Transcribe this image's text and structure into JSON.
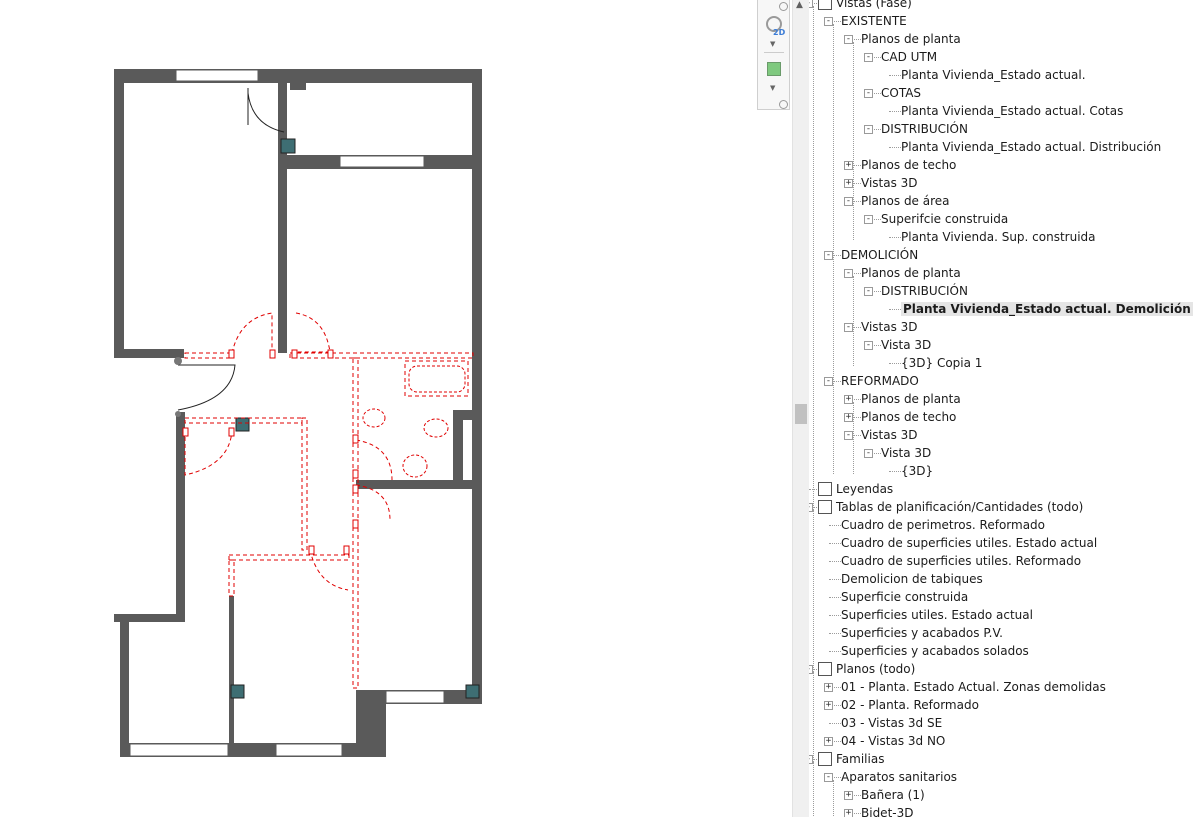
{
  "tree": {
    "rows": [
      {
        "id": "r0",
        "label": "Vistas (Fase)",
        "level": 0,
        "exp": "-",
        "icon": "view-folder-icon"
      },
      {
        "id": "r1",
        "label": "EXISTENTE",
        "level": 1,
        "exp": "-"
      },
      {
        "id": "r2",
        "label": "Planos de planta",
        "level": 2,
        "exp": "-"
      },
      {
        "id": "r3",
        "label": "CAD UTM",
        "level": 3,
        "exp": "-"
      },
      {
        "id": "r4",
        "label": "Planta Vivienda_Estado actual.",
        "level": 4
      },
      {
        "id": "r5",
        "label": "COTAS",
        "level": 3,
        "exp": "-"
      },
      {
        "id": "r6",
        "label": "Planta Vivienda_Estado actual. Cotas",
        "level": 4
      },
      {
        "id": "r7",
        "label": "DISTRIBUCIÓN",
        "level": 3,
        "exp": "-"
      },
      {
        "id": "r8",
        "label": "Planta Vivienda_Estado actual. Distribución",
        "level": 4
      },
      {
        "id": "r9",
        "label": "Planos de techo",
        "level": 2,
        "exp": "+"
      },
      {
        "id": "r10",
        "label": "Vistas 3D",
        "level": 2,
        "exp": "+"
      },
      {
        "id": "r11",
        "label": "Planos de área",
        "level": 2,
        "exp": "-"
      },
      {
        "id": "r12",
        "label": "Superifcie construida",
        "level": 3,
        "exp": "-"
      },
      {
        "id": "r13",
        "label": "Planta Vivienda. Sup. construida",
        "level": 4
      },
      {
        "id": "r14",
        "label": "DEMOLICIÓN",
        "level": 1,
        "exp": "-"
      },
      {
        "id": "r15",
        "label": "Planos de planta",
        "level": 2,
        "exp": "-"
      },
      {
        "id": "r16",
        "label": "DISTRIBUCIÓN",
        "level": 3,
        "exp": "-"
      },
      {
        "id": "r17",
        "label": "Planta Vivienda_Estado actual. Demolición",
        "level": 4,
        "selected": true
      },
      {
        "id": "r18",
        "label": "Vistas 3D",
        "level": 2,
        "exp": "-"
      },
      {
        "id": "r19",
        "label": "Vista 3D",
        "level": 3,
        "exp": "-"
      },
      {
        "id": "r20",
        "label": "{3D} Copia 1",
        "level": 4
      },
      {
        "id": "r21",
        "label": "REFORMADO",
        "level": 1,
        "exp": "-"
      },
      {
        "id": "r22",
        "label": "Planos de planta",
        "level": 2,
        "exp": "+"
      },
      {
        "id": "r23",
        "label": "Planos de techo",
        "level": 2,
        "exp": "+"
      },
      {
        "id": "r24",
        "label": "Vistas 3D",
        "level": 2,
        "exp": "-"
      },
      {
        "id": "r25",
        "label": "Vista 3D",
        "level": 3,
        "exp": "-"
      },
      {
        "id": "r26",
        "label": "{3D}",
        "level": 4
      },
      {
        "id": "r27",
        "label": "Leyendas",
        "level": 0,
        "icon": "legend-icon"
      },
      {
        "id": "r28",
        "label": "Tablas de planificación/Cantidades (todo)",
        "level": 0,
        "exp": "-",
        "icon": "schedule-icon"
      },
      {
        "id": "r29",
        "label": "Cuadro de perimetros. Reformado",
        "level": 1
      },
      {
        "id": "r30",
        "label": "Cuadro de superficies utiles. Estado actual",
        "level": 1
      },
      {
        "id": "r31",
        "label": "Cuadro de superficies utiles. Reformado",
        "level": 1
      },
      {
        "id": "r32",
        "label": "Demolicion de tabiques",
        "level": 1
      },
      {
        "id": "r33",
        "label": "Superficie construida",
        "level": 1
      },
      {
        "id": "r34",
        "label": "Superficies utiles. Estado actual",
        "level": 1
      },
      {
        "id": "r35",
        "label": "Superficies y acabados P.V.",
        "level": 1
      },
      {
        "id": "r36",
        "label": "Superficies y acabados solados",
        "level": 1
      },
      {
        "id": "r37",
        "label": "Planos (todo)",
        "level": 0,
        "exp": "-",
        "icon": "sheets-icon"
      },
      {
        "id": "r38",
        "label": "01 - Planta. Estado Actual.  Zonas demolidas",
        "level": 1,
        "exp": "+"
      },
      {
        "id": "r39",
        "label": "02 - Planta. Reformado",
        "level": 1,
        "exp": "+"
      },
      {
        "id": "r40",
        "label": "03 - Vistas 3d SE",
        "level": 1
      },
      {
        "id": "r41",
        "label": "04 - Vistas 3d NO",
        "level": 1,
        "exp": "+"
      },
      {
        "id": "r42",
        "label": "Familias",
        "level": 0,
        "exp": "-",
        "icon": "families-icon"
      },
      {
        "id": "r43",
        "label": "Aparatos sanitarios",
        "level": 1,
        "exp": "-"
      },
      {
        "id": "r44",
        "label": "Bañera (1)",
        "level": 2,
        "exp": "+"
      },
      {
        "id": "r45",
        "label": "Bidet-3D",
        "level": 2,
        "exp": "+"
      }
    ]
  },
  "navbar": {
    "badge": "2D"
  },
  "colors": {
    "wall": "#5a5a5a",
    "demolition": "#e00000",
    "column": "#3e6e73",
    "selection": "#e5e5e5"
  }
}
